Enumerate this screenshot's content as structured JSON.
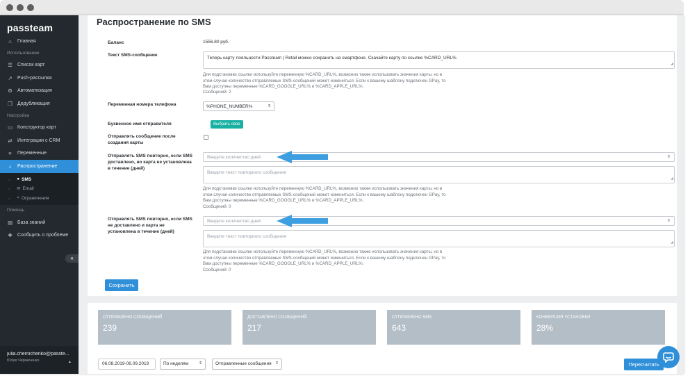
{
  "sidebar": {
    "logo": "passteam",
    "sections": {
      "usage": "Использование",
      "settings": "Настройка",
      "help": "Помощь"
    },
    "items": {
      "home": "Главная",
      "cards": "Список карт",
      "push": "Push-рассылка",
      "automation": "Автоматизация",
      "dedup": "Дедубликация",
      "constructor": "Конструктор карт",
      "crm": "Интеграции с CRM",
      "variables": "Переменные",
      "distribution": "Распространение",
      "kb": "База знаний",
      "report": "Сообщить о проблеме"
    },
    "sub": {
      "sms": "SMS",
      "email": "Email",
      "limits": "Ограничения"
    },
    "collapse": "«",
    "user": {
      "email": "julia.chernichenko@passte...",
      "name": "Юлия Черниченко"
    }
  },
  "page": {
    "title": "Распространение по SMS",
    "balance_label": "Баланс",
    "balance_value": "1556.80 руб.",
    "sms_text_label": "Текст SMS-сообщение",
    "sms_text_value": "Теперь карту лояльности Passteam | Retail можно сохранить на смартфоне. Скачайте карту по ссылке %CARD_URL%",
    "hint1": "Для подстановки ссылки используйте переменную %CARD_URL%, возможно также использовать значения карты, но в этом случае количество отправляемых SMS-сообщений может измениться. Если к вашему шаблону подключен GPay, то Вам доступны переменные %CARD_GOOGLE_URL% и %CARD_APPLE_URL%.",
    "messages1": "Сообщений: 2",
    "phone_label": "Переменная номера телефона",
    "phone_value": "%PHONE_NUMBER%",
    "sender_label": "Буквенное имя отправителя",
    "sender_button": "Выбрать свое",
    "after_create_label": "Отправлять сообщение после создания карты",
    "resend1_label": "Отправлять SMS повторно, если SMS доставлено, но карта не установлена в течение (дней)",
    "days_placeholder": "Введите количество дней",
    "repeat_placeholder": "Введите текст повторного сообщения",
    "hint2": "Для подстановки ссылки используйте переменную %CARD_URL%, возможно также использовать значения карты, но в этом случае количество отправляемых SMS-сообщений может измениться. Если к вашему шаблону подключен GPay, то Вам доступны переменные %CARD_GOOGLE_URL% и %CARD_APPLE_URL%.",
    "messages2": "Сообщений: 0",
    "resend2_label": "Отправлять SMS повторно, если SMS не доставлено и карта не установлена в течение (дней)",
    "hint3": "Для подстановки ссылки используйте переменную %CARD_URL%, возможно также использовать значения карты, но в этом случае количество отправляемых SMS-сообщений может измениться. Если к вашему шаблону подключен GPay, то Вам доступны переменные %CARD_GOOGLE_URL% и %CARD_APPLE_URL%.",
    "messages3": "Сообщений: 0",
    "save_button": "Сохранить"
  },
  "stats": [
    {
      "label": "ОТПРАВЛЕНО СООБЩЕНИЙ",
      "value": "239"
    },
    {
      "label": "ДОСТАВЛЕНО СООБЩЕНИЙ",
      "value": "217"
    },
    {
      "label": "ОТПРАВЛЕНО SMS",
      "value": "643"
    },
    {
      "label": "КОНВЕРСИЯ УСТАНОВКИ",
      "value": "28%"
    }
  ],
  "filters": {
    "date_range": "06.08.2019-06.09.2019",
    "period": "По неделям",
    "metric": "Отправленные сообщения",
    "recalc_button": "Пересчитать"
  },
  "colors": {
    "accent": "#2f8fd8",
    "sidebar_bg": "#23292e",
    "teal": "#17b0a3",
    "stat_bg": "#b4bec6",
    "annotation_arrow": "#3d9ee0"
  }
}
